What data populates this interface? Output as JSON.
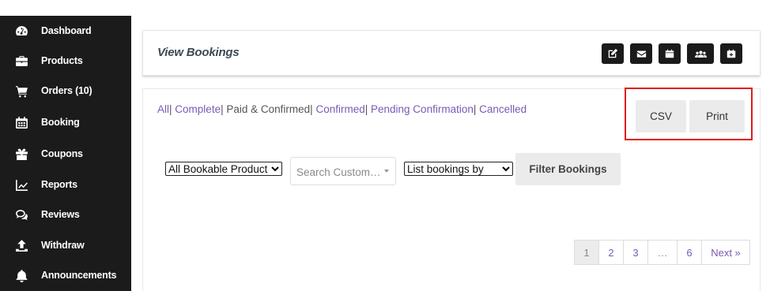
{
  "sidebar": {
    "items": [
      {
        "label": "Dashboard",
        "icon": "dashboard-icon"
      },
      {
        "label": "Products",
        "icon": "briefcase-icon"
      },
      {
        "label": "Orders (10)",
        "icon": "cart-icon"
      },
      {
        "label": "Booking",
        "icon": "calendar-icon"
      },
      {
        "label": "Coupons",
        "icon": "gift-icon"
      },
      {
        "label": "Reports",
        "icon": "chart-icon"
      },
      {
        "label": "Reviews",
        "icon": "comments-icon"
      },
      {
        "label": "Withdraw",
        "icon": "upload-icon"
      },
      {
        "label": "Announcements",
        "icon": "bell-icon"
      }
    ]
  },
  "header": {
    "title": "View Bookings",
    "buttons": [
      "edit-icon",
      "envelope-icon",
      "calendar-icon",
      "users-icon",
      "calendar-plus-icon"
    ]
  },
  "filters": {
    "all": "All",
    "complete": "Complete",
    "paid_confirmed": "Paid & Confirmed",
    "confirmed": "Confirmed",
    "pending": "Pending Confirmation",
    "cancelled": "Cancelled",
    "sep": "|"
  },
  "export": {
    "csv": "CSV",
    "print": "Print"
  },
  "controls": {
    "product_select": "All Bookable Product",
    "search_placeholder": "Search Custom…",
    "list_select": "List bookings by",
    "filter_button": "Filter Bookings"
  },
  "pagination": {
    "pages": [
      "1",
      "2",
      "3",
      "…",
      "6"
    ],
    "next": "Next »"
  },
  "colors": {
    "sidebar_bg": "#1b1b1b",
    "link": "#7a5ab5",
    "highlight": "#e11b1b"
  }
}
